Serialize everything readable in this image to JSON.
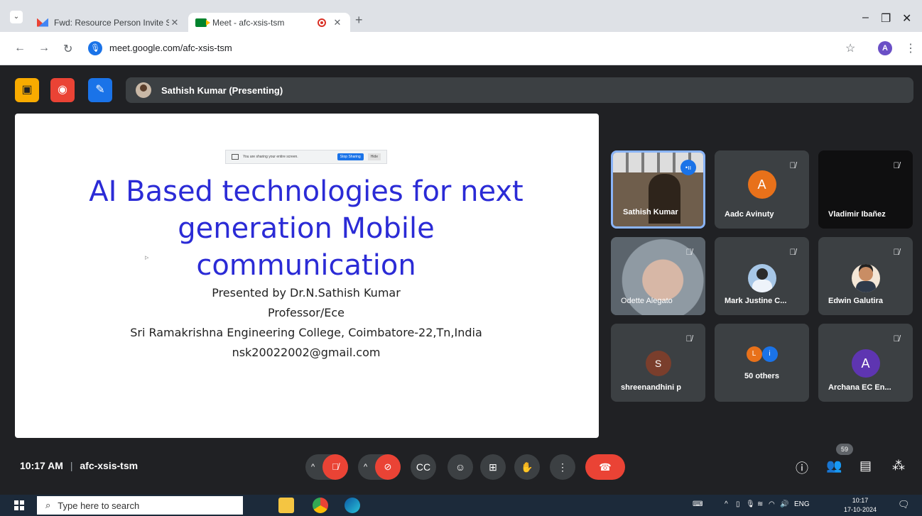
{
  "browser": {
    "tabs": [
      {
        "title": "Fwd: Resource Person Invite Sa",
        "icon": "gmail-icon"
      },
      {
        "title": "Meet - afc-xsis-tsm",
        "icon": "meet-icon"
      }
    ],
    "url": "meet.google.com/afc-xsis-tsm",
    "profile_initial": "A"
  },
  "meet": {
    "presenter_label": "Sathish Kumar (Presenting)",
    "slide": {
      "share_banner": "You are sharing your entire screen.",
      "stop_sharing": "Stop Sharing",
      "hide": "Hide",
      "title_lines": [
        "AI Based technologies for next",
        "generation Mobile",
        "communication"
      ],
      "subtitle_lines": [
        "Presented by Dr.N.Sathish Kumar",
        "Professor/Ece",
        "Sri Ramakrishna Engineering College, Coimbatore-22,Tn,India",
        "nsk20022002@gmail.com"
      ]
    },
    "participants": [
      {
        "name": "Sathish Kumar"
      },
      {
        "name": "Aadc Avinuty",
        "initial": "A",
        "color": "#e8711a"
      },
      {
        "name": "Vladimir Ibañez"
      },
      {
        "name": "Odette Alegato"
      },
      {
        "name": "Mark Justine C..."
      },
      {
        "name": "Edwin Galutira"
      },
      {
        "name": "shreenandhini p",
        "initial": "S",
        "color": "#7a3e2c"
      },
      {
        "name": "50 others",
        "initials": [
          "L",
          "i"
        ],
        "colors": [
          "#e8711a",
          "#1a73e8"
        ]
      },
      {
        "name": "Archana EC En...",
        "initial": "A",
        "color": "#5e35b1"
      }
    ],
    "bottom": {
      "time": "10:17 AM",
      "separator": "|",
      "meeting_code": "afc-xsis-tsm",
      "participant_count": "59"
    },
    "colors": {
      "end_call": "#ea4335",
      "muted": "#ea4335",
      "bg": "#202124"
    }
  },
  "taskbar": {
    "search_placeholder": "Type here to search",
    "lang": "ENG",
    "time": "10:17",
    "date": "17-10-2024"
  }
}
